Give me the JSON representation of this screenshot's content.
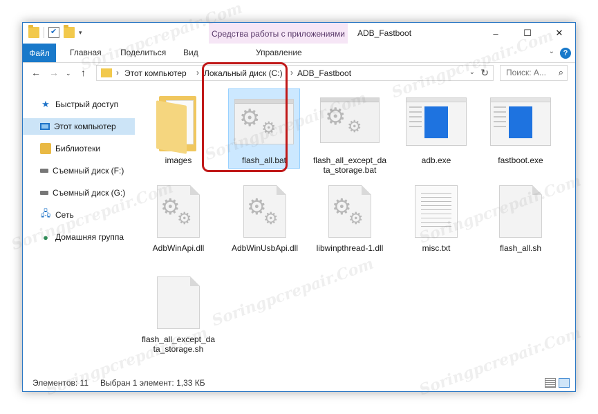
{
  "window": {
    "title": "ADB_Fastboot",
    "context_tab_group": "Средства работы с приложениями",
    "controls": [
      "–",
      "☐",
      "✕"
    ]
  },
  "ribbon": {
    "tabs": [
      "Файл",
      "Главная",
      "Поделиться",
      "Вид",
      "Управление"
    ],
    "help": "?"
  },
  "address": {
    "crumbs": [
      "Этот компьютер",
      "Локальный диск (C:)",
      "ADB_Fastboot"
    ],
    "search_placeholder": "Поиск: A..."
  },
  "sidebar": {
    "items": [
      {
        "label": "Быстрый доступ",
        "icon": "star-icon"
      },
      {
        "label": "Этот компьютер",
        "icon": "computer-icon",
        "selected": true
      },
      {
        "label": "Библиотеки",
        "icon": "library-icon"
      },
      {
        "label": "Съемный диск (F:)",
        "icon": "drive-icon"
      },
      {
        "label": "Съемный диск (G:)",
        "icon": "drive-icon"
      },
      {
        "label": "Сеть",
        "icon": "network-icon"
      },
      {
        "label": "Домашняя группа",
        "icon": "homegroup-icon"
      }
    ]
  },
  "files": [
    {
      "name": "images",
      "type": "folder"
    },
    {
      "name": "flash_all.bat",
      "type": "bat",
      "selected": true
    },
    {
      "name": "flash_all_except_data_storage.bat",
      "type": "bat"
    },
    {
      "name": "adb.exe",
      "type": "exe"
    },
    {
      "name": "fastboot.exe",
      "type": "exe"
    },
    {
      "name": "AdbWinApi.dll",
      "type": "dll"
    },
    {
      "name": "AdbWinUsbApi.dll",
      "type": "dll"
    },
    {
      "name": "libwinpthread-1.dll",
      "type": "dll"
    },
    {
      "name": "misc.txt",
      "type": "txt"
    },
    {
      "name": "flash_all.sh",
      "type": "sh"
    },
    {
      "name": "flash_all_except_data_storage.sh",
      "type": "sh"
    }
  ],
  "status": {
    "items_count": "Элементов: 11",
    "selection": "Выбран 1 элемент: 1,33 КБ"
  },
  "watermark": "Soringpcrepair.Com",
  "colors": {
    "accent": "#1979ca",
    "selection_bg": "#cce8ff",
    "context_tab_bg": "#f6e6f6",
    "highlight_frame": "#c01818"
  }
}
